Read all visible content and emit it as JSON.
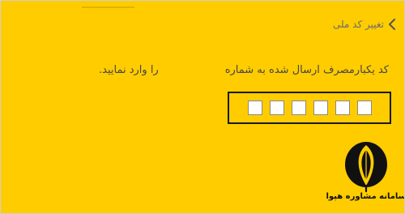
{
  "header": {
    "back_label": "تغییر کد ملی",
    "back_icon": "chevron-left-icon"
  },
  "message": {
    "main": "کد یکبارمصرف ارسال شده به شماره",
    "tail": "را وارد نمایید."
  },
  "code_input": {
    "digits": [
      "",
      "",
      "",
      "",
      "",
      ""
    ]
  },
  "logo": {
    "text": "سامانه مشاوره هپوا",
    "icon": "feather-quill-icon"
  },
  "colors": {
    "background": "#ffcc00",
    "text": "#444444",
    "box_border": "#1a1a1a"
  }
}
